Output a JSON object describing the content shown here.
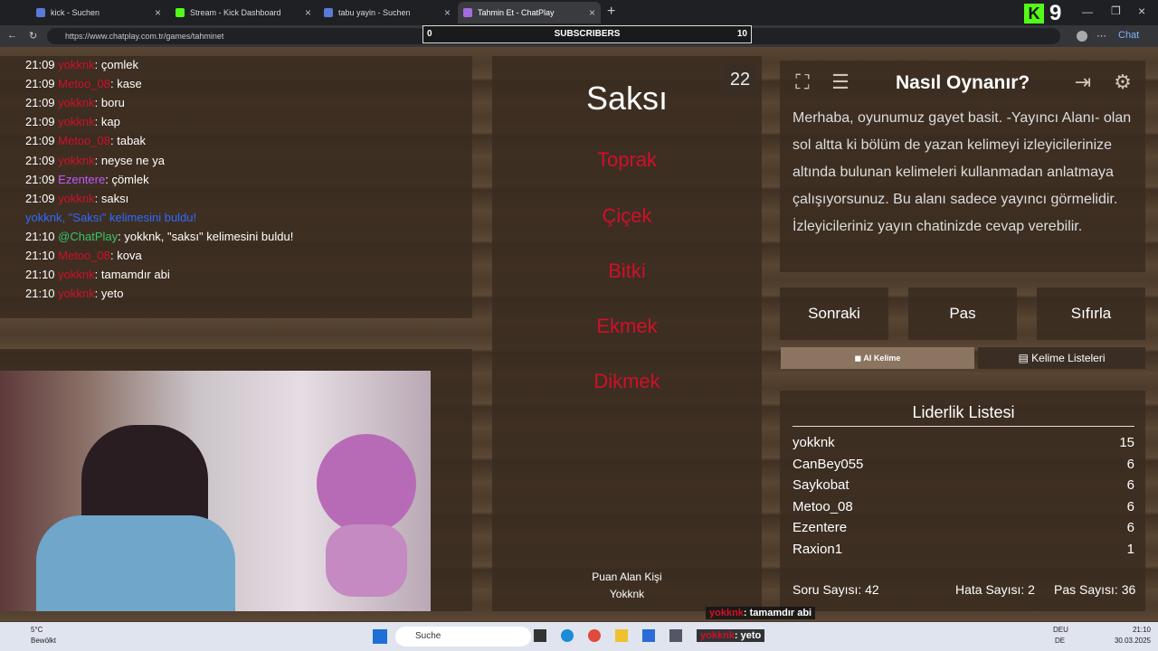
{
  "tabs": [
    {
      "label": "kick - Suchen",
      "color": "#5b7bd5",
      "active": false
    },
    {
      "label": "Stream - Kick Dashboard",
      "color": "#53fc18",
      "active": false
    },
    {
      "label": "tabu yayin - Suchen",
      "color": "#5b7bd5",
      "active": false
    },
    {
      "label": "Tahmin Et - ChatPlay",
      "color": "#a36be0",
      "active": true
    }
  ],
  "browser": {
    "url": "https://www.chatplay.com.tr/games/tahminet",
    "new_tab": "+",
    "chat_label": "Chat"
  },
  "subscribers": {
    "label": "SUBSCRIBERS",
    "current": "0",
    "goal": "10"
  },
  "kick_overlay": {
    "badge": "K",
    "count": "9"
  },
  "chat": [
    {
      "time": "21:09",
      "user": "yokknk",
      "color": "#d0102a",
      "msg": ": çomlek"
    },
    {
      "time": "21:09",
      "user": "Metoo_08",
      "color": "#d0102a",
      "msg": ": kase"
    },
    {
      "time": "21:09",
      "user": "yokknk",
      "color": "#d0102a",
      "msg": ": boru"
    },
    {
      "time": "21:09",
      "user": "yokknk",
      "color": "#d0102a",
      "msg": ": kap"
    },
    {
      "time": "21:09",
      "user": "Metoo_08",
      "color": "#d0102a",
      "msg": ": tabak"
    },
    {
      "time": "21:09",
      "user": "yokknk",
      "color": "#d0102a",
      "msg": ": neyse ne ya"
    },
    {
      "time": "21:09",
      "user": "Ezentere",
      "color": "#c058ff",
      "msg": ": çömlek"
    },
    {
      "time": "21:09",
      "user": "yokknk",
      "color": "#d0102a",
      "msg": ": saksı"
    },
    {
      "time": "",
      "user": "",
      "color": "#2e6bff",
      "msg": "yokknk, \"Saksı\" kelimesini buldu!"
    },
    {
      "time": "21:10",
      "user": "@ChatPlay",
      "color": "#34c46a",
      "msg": ": yokknk, \"saksı\" kelimesini buldu!"
    },
    {
      "time": "21:10",
      "user": "Metoo_08",
      "color": "#d0102a",
      "msg": ": kova"
    },
    {
      "time": "21:10",
      "user": "yokknk",
      "color": "#d0102a",
      "msg": ": tamamdır abi"
    },
    {
      "time": "21:10",
      "user": "yokknk",
      "color": "#d0102a",
      "msg": ": yeto"
    }
  ],
  "game": {
    "word": "Saksı",
    "counter": "22",
    "forbidden": [
      "Toprak",
      "Çiçek",
      "Bitki",
      "Ekmek",
      "Dikmek"
    ],
    "scorer_label": "Puan Alan Kişi",
    "scorer_name": "Yokknk"
  },
  "howto": {
    "title": "Nasıl Oynanır?",
    "text": "Merhaba, oyunumuz gayet basit. -Yayıncı Alanı- olan sol altta ki bölüm de yazan kelimeyi izleyicilerinize altında bulunan kelimeleri kullanmadan anlatmaya çalışıyorsunuz. Bu alanı sadece yayıncı görmelidir. İzleyicileriniz yayın chatinizde cevap verebilir."
  },
  "buttons": {
    "next": "Sonraki",
    "pass": "Pas",
    "reset": "Sıfırla",
    "ai_word": "AI Kelime",
    "word_lists": "Kelime Listeleri"
  },
  "leaderboard": {
    "title": "Liderlik Listesi",
    "rows": [
      {
        "name": "yokknk",
        "score": "15"
      },
      {
        "name": "CanBey055",
        "score": "6"
      },
      {
        "name": "Saykobat",
        "score": "6"
      },
      {
        "name": "Metoo_08",
        "score": "6"
      },
      {
        "name": "Ezentere",
        "score": "6"
      },
      {
        "name": "Raxion1",
        "score": "1"
      }
    ],
    "stats": {
      "questions": "Soru Sayısı: 42",
      "errors": "Hata Sayısı: 2",
      "passes": "Pas Sayısı: 36"
    }
  },
  "overlay_chat": [
    {
      "user": "yokknk",
      "msg": ": tamamdır abi"
    },
    {
      "user": "yokknk",
      "msg": ": yeto"
    }
  ],
  "taskbar": {
    "weather_temp": "5°C",
    "weather_text": "Bewölkt",
    "search": "Suche",
    "lang1": "DEU",
    "lang2": "DE",
    "time": "21:10",
    "date": "30.03.2025"
  }
}
